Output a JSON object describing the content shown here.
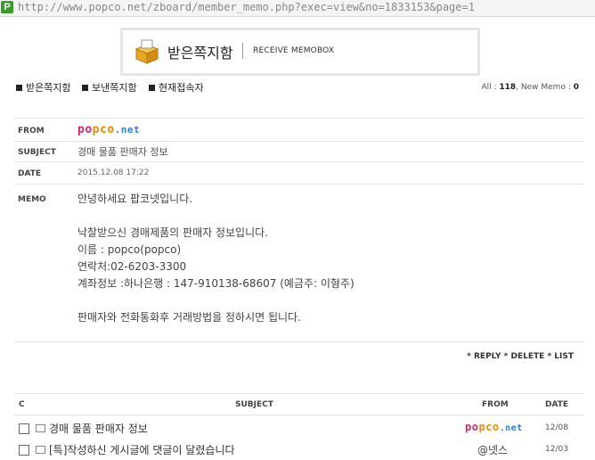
{
  "browser": {
    "url": "http://www.popco.net/zboard/member_memo.php?exec=view&no=1833153&page=1",
    "favicon": "P"
  },
  "header": {
    "title": "받은쪽지함",
    "subtitle": "RECEIVE MEMOBOX",
    "icon": "memobox-icon"
  },
  "nav": {
    "items": [
      {
        "label": "받은쪽지함"
      },
      {
        "label": "보낸쪽지함"
      },
      {
        "label": "현재접속자"
      }
    ]
  },
  "counts": {
    "all_label": "All :",
    "all_value": "118",
    "new_label": ", New Memo :",
    "new_value": "0"
  },
  "memo": {
    "from_label": "FROM",
    "subject_label": "SUBJECT",
    "date_label": "DATE",
    "memo_label": "MEMO",
    "from": {
      "p1": "po",
      "p2": "pco",
      "p3": ".net"
    },
    "subject": "경매 물품 판매자 정보",
    "date": "2015.12.08 17:22",
    "body": "안녕하세요 팝코넷입니다.\n\n낙찰받으신 경매제품의 판매자 정보입니다.\n이름 : popco(popco)\n연락처:02-6203-3300\n계좌정보 :하나은행 : 147-910138-68607 (예금주: 이형주)\n\n판매자와 전화통화후 거래방법을 정하시면 됩니다."
  },
  "actions": {
    "reply": "* REPLY",
    "delete": "* DELETE",
    "list": "* LIST"
  },
  "list": {
    "headers": {
      "c": "C",
      "subject": "SUBJECT",
      "from": "FROM",
      "date": "DATE"
    },
    "rows": [
      {
        "subject": "경매 물품 판매자 정보",
        "from": {
          "p1": "po",
          "p2": "pco",
          "p3": ".net"
        },
        "date": "12/08"
      },
      {
        "subject": "[특]작성하신 게시글에 댓글이 달렸습니다",
        "from": "@넷스",
        "date": "12/03"
      }
    ]
  },
  "colors": {
    "brand_red": "#d6246e",
    "brand_orange": "#f08a00",
    "brand_blue": "#2a7fd4"
  }
}
